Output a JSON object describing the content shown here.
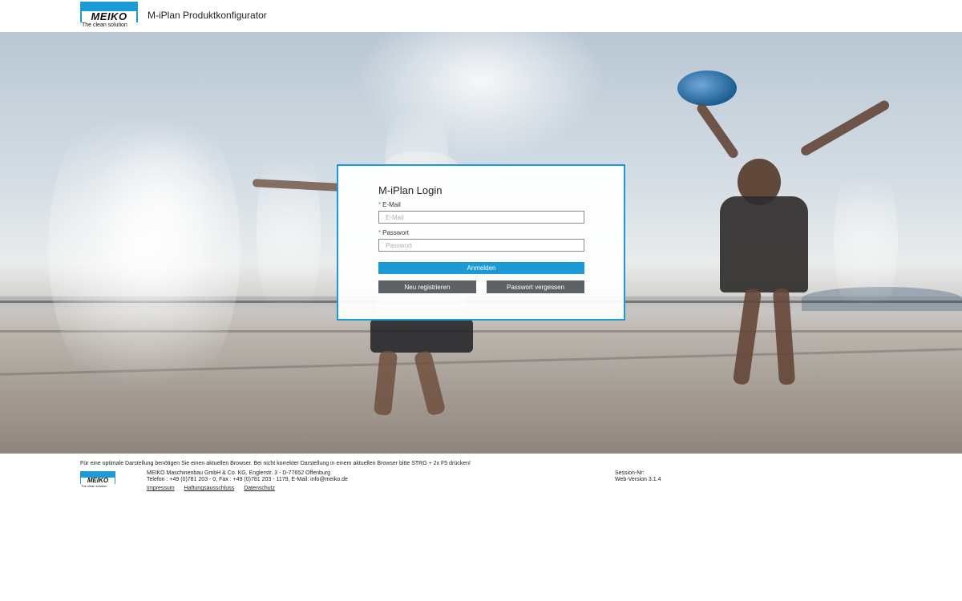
{
  "header": {
    "logo_text": "MEIKO",
    "logo_tagline": "The clean solution",
    "app_title": "M-iPlan Produktkonfigurator"
  },
  "login": {
    "title": "M-iPlan Login",
    "email_label": "E-Mail",
    "email_placeholder": "E-Mail",
    "email_value": "",
    "password_label": "Passwort",
    "password_placeholder": "Passwort",
    "password_value": "",
    "required_marker": "*",
    "login_button": "Anmelden",
    "register_button": "Neu registrieren",
    "forgot_button": "Passwort vergessen"
  },
  "footer": {
    "notice": "Für eine optimale Darstellung benötigen Sie einen aktuellen Browser. Bei nicht korrekter Darstellung in einem aktuellen Browser bitte STRG + 2x F5 drücken!",
    "company_line": "MEIKO Maschinenbau GmbH & Co. KG, Englerstr. 3 - D-77652 Offenburg",
    "contact_line": "Telefon : +49 (0)781 203 - 0, Fax : +49 (0)781 203 - 1179, E-Mail: info@meiko.de",
    "links": [
      "Impressum",
      "Haftungsausschluss",
      "Datenschutz"
    ],
    "session_label": "Session-Nr:",
    "version_label": "Web-Version 3.1.4"
  },
  "colors": {
    "accent": "#1b9ad6",
    "secondary_button": "#5d6266"
  }
}
